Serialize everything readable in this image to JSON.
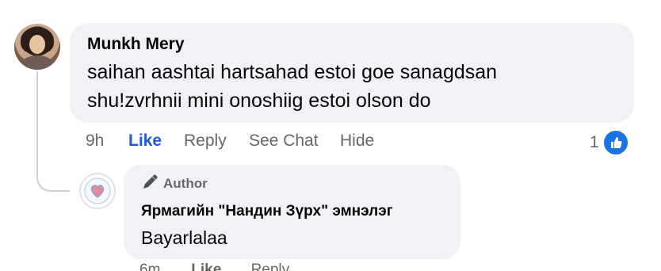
{
  "comment": {
    "author": "Munkh Mery",
    "lines": [
      "saihan aashtai hartsahad estoi goe sanagdsan",
      "shu!zvrhnii mini onoshiig estoi olson do"
    ],
    "time": "9h",
    "like_label": "Like",
    "reply_label": "Reply",
    "see_chat_label": "See Chat",
    "hide_label": "Hide",
    "reaction_count": "1",
    "reaction_icon": "thumbs-up-icon",
    "like_color": "#1b5ae3"
  },
  "reply": {
    "badge_label": "Author",
    "badge_icon": "pen-icon",
    "author": "Ярмагийн \"Нандин Зүрх\" эмнэлэг",
    "text": "Bayarlalaa",
    "time": "6m",
    "like_label": "Like",
    "reply_label": "Reply"
  }
}
